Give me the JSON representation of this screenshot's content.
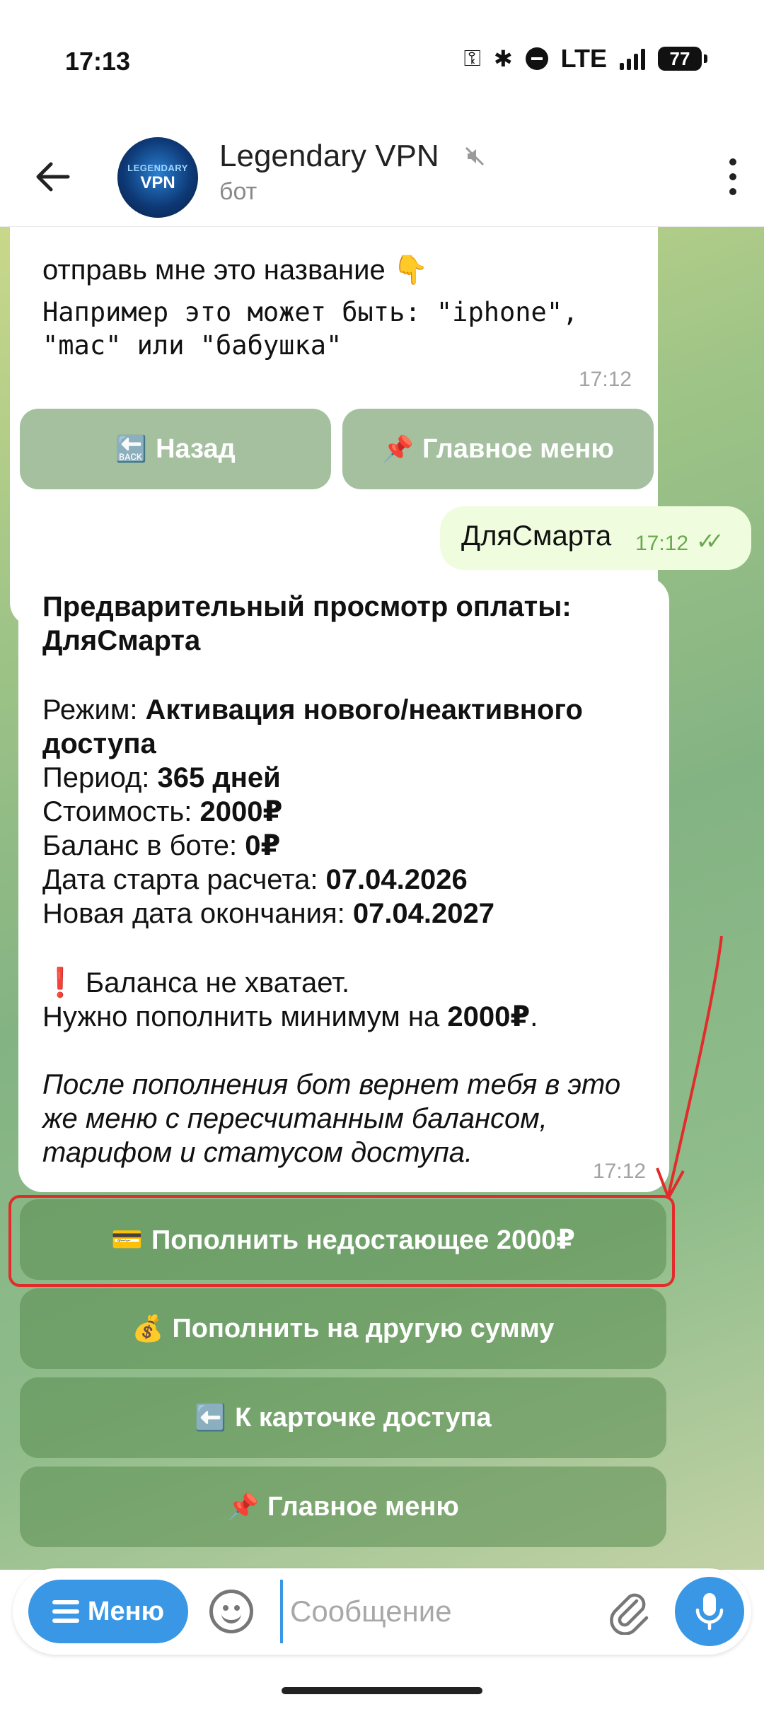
{
  "status_bar": {
    "time": "17:13",
    "network": "LTE",
    "battery": "77",
    "icons": [
      "key-icon",
      "bluetooth-icon",
      "do-not-disturb-icon",
      "signal-icon",
      "battery-icon"
    ]
  },
  "header": {
    "title": "Legendary VPN",
    "subtitle": "бот",
    "avatar_text_1": "LEGENDARY",
    "avatar_text_2": "VPN"
  },
  "messages": {
    "top": {
      "line1": "отправь мне это название 👇",
      "example": "Например это может быть: \"iphone\", \"mac\" или \"бабушка\"",
      "time": "17:12"
    },
    "top_keyboard": [
      {
        "emoji": "🔙",
        "label": "Назад"
      },
      {
        "emoji": "📌",
        "label": "Главное меню"
      }
    ],
    "outgoing": {
      "text": "ДляСмарта",
      "time": "17:12",
      "status": "read"
    },
    "main": {
      "title_line1": "Предварительный просмотр оплаты:",
      "title_line2": "ДляСмарта",
      "mode_label": "Режим: ",
      "mode_value_1": "Активация нового/неактивного",
      "mode_value_2": "доступа",
      "period_label": "Период: ",
      "period_value": "365 дней",
      "cost_label": "Стоимость: ",
      "cost_value": "2000₽",
      "balance_label": "Баланс в боте: ",
      "balance_value": "0₽",
      "start_label": "Дата старта расчета: ",
      "start_value": "07.04.2026",
      "end_label": "Новая дата окончания: ",
      "end_value": "07.04.2027",
      "warning_emoji": "❗",
      "warning": " Баланса не хватает.",
      "need_label": "Нужно пополнить минимум на ",
      "need_value": "2000₽",
      "need_suffix": ".",
      "note": "После пополнения бот вернет тебя в это же меню с пересчитанным балансом, тарифом и статусом доступа.",
      "time": "17:12"
    },
    "main_keyboard": [
      {
        "emoji": "💳",
        "label": "Пополнить недостающее 2000₽"
      },
      {
        "emoji": "💰",
        "label": "Пополнить на другую сумму"
      },
      {
        "emoji": "⬅️",
        "label": "К карточке доступа"
      },
      {
        "emoji": "📌",
        "label": "Главное меню"
      }
    ]
  },
  "annotation": {
    "color": "#e22c2c"
  },
  "input_bar": {
    "menu_label": "Меню",
    "placeholder": "Сообщение"
  },
  "colors": {
    "accent": "#3a97e6",
    "outgoing_bubble": "#effdde",
    "read_check": "#6aa84f"
  }
}
